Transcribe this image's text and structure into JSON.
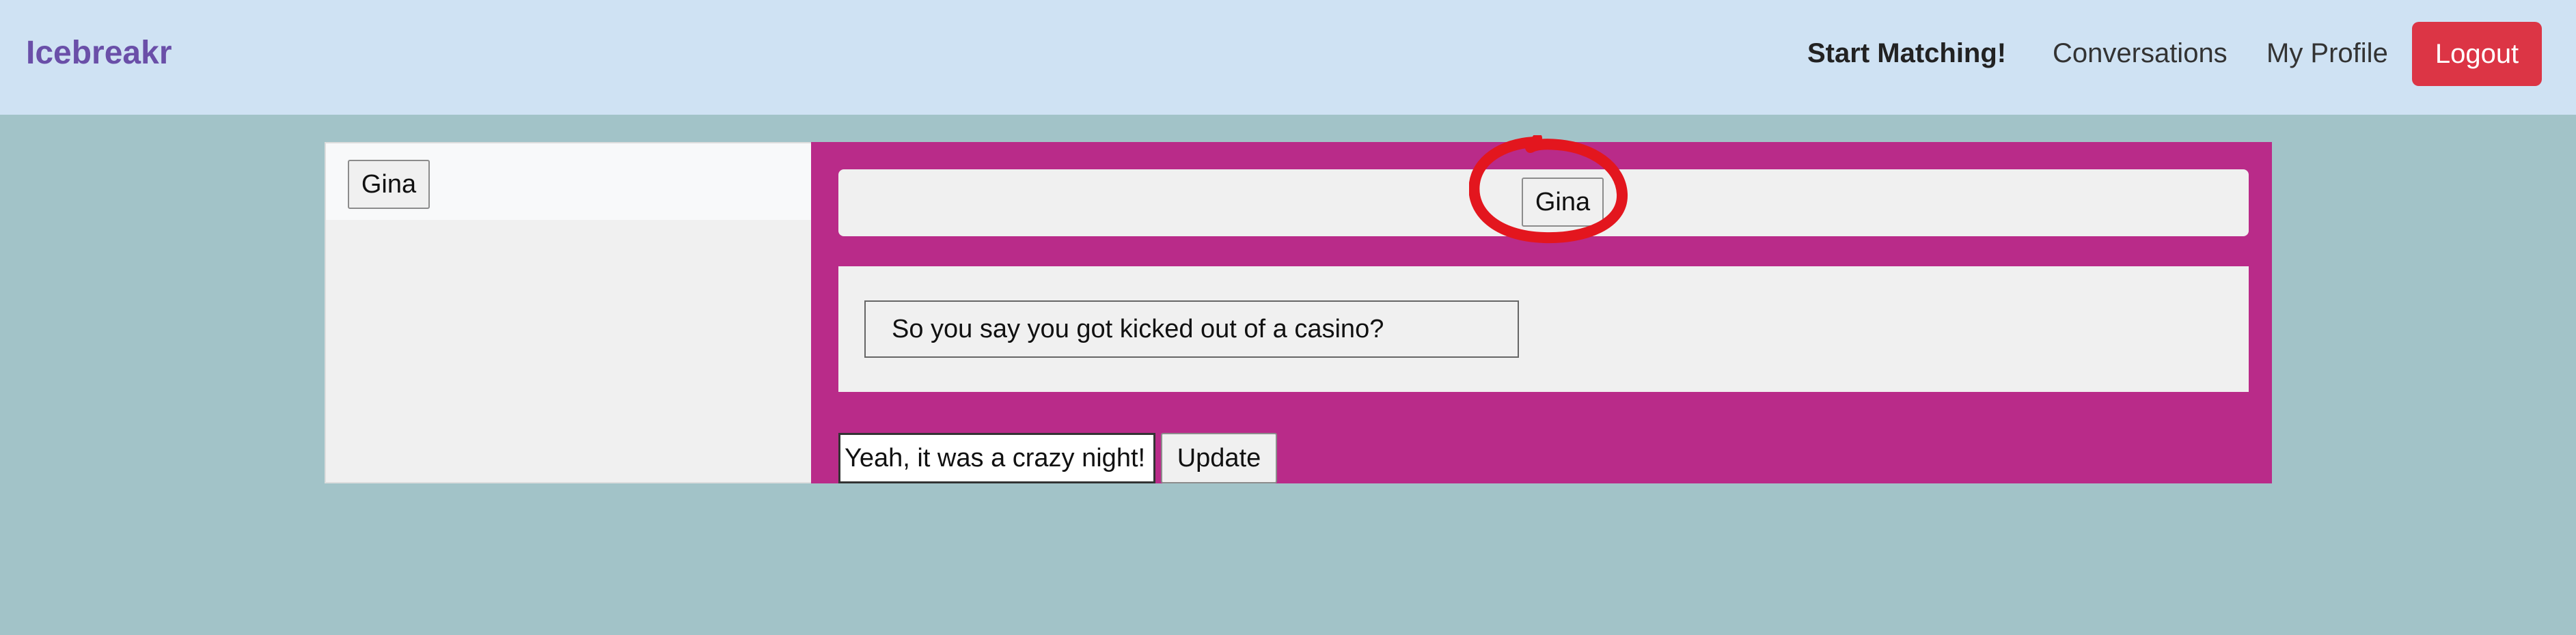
{
  "navbar": {
    "brand": "Icebreakr",
    "start_matching": "Start Matching!",
    "conversations": "Conversations",
    "my_profile": "My Profile",
    "logout": "Logout"
  },
  "sidebar": {
    "items": [
      {
        "label": "Gina"
      }
    ]
  },
  "chat": {
    "header_name": "Gina",
    "messages": [
      {
        "text": "So you say you got kicked out of a casino?"
      }
    ],
    "reply_value": "Yeah, it was a crazy night!",
    "update_label": "Update"
  },
  "colors": {
    "navbar_bg": "#cfe2f3",
    "page_bg": "#a2c3c8",
    "brand": "#6a4fa8",
    "logout_bg": "#dc3545",
    "chat_bg": "#b92b89",
    "annotation": "#e3161e"
  }
}
